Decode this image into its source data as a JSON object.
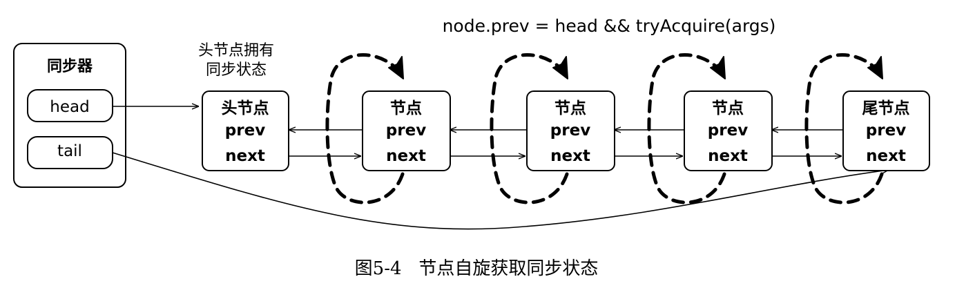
{
  "condition": "node.prev = head && tryAcquire(args)",
  "sync": {
    "title": "同步器",
    "head": "head",
    "tail": "tail"
  },
  "head_note": {
    "line1": "头节点拥有",
    "line2": "同步状态"
  },
  "nodes": [
    {
      "title": "头节点",
      "prev": "prev",
      "next": "next"
    },
    {
      "title": "节点",
      "prev": "prev",
      "next": "next"
    },
    {
      "title": "节点",
      "prev": "prev",
      "next": "next"
    },
    {
      "title": "节点",
      "prev": "prev",
      "next": "next"
    },
    {
      "title": "尾节点",
      "prev": "prev",
      "next": "next"
    }
  ],
  "caption": "图5-4   节点自旋获取同步状态"
}
